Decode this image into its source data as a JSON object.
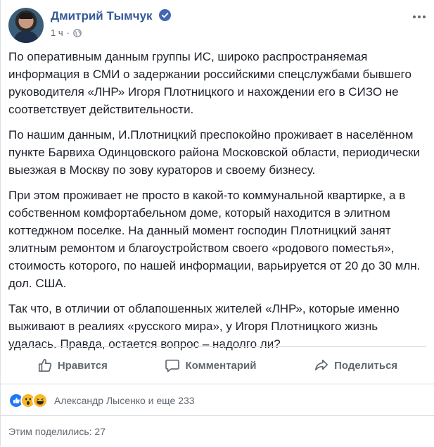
{
  "post": {
    "author": "Дмитрий Тымчук",
    "time": "1 ч",
    "paragraphs": [
      "По оперативным данным группы ИС, широко распространяемая информация в СМИ о задержании российскими спецслужбами бывшего руководителя «ЛНР» Игоря Плотницкого и нахождении его в СИЗО не соответствует действительности.",
      "По нашим данным, И.Плотницкий преспокойно проживает в населённом пункте Барвиха Одинцовского района Московской области, периодически выезжая в Москву по зову кураторов и своему бизнесу.",
      "При этом проживает не просто в какой-то коммунальной квартирке, а в собственном комфортабельном доме, который находится в элитном коттеджном поселке. На данный момент господин Плотницкий занят элитным ремонтом и благоустройством своего «родового поместья», стоимость которого, по нашей информации, варьируется от 20 до 30 млн. дол. США.",
      "Так что, в отличии от облапошенных жителей «ЛНР», которые именно выживают в реалиях «русского мира», у Игоря Плотницкого жизнь удалась. Правда, остается вопрос – надолго ли?"
    ]
  },
  "actions": {
    "like": "Нравится",
    "comment": "Комментарий",
    "share": "Поделиться"
  },
  "reactions": {
    "text": "Александр Лысенко и еще 233",
    "icons": [
      "like-icon",
      "wow-icon",
      "haha-icon"
    ]
  },
  "shares": {
    "text": "Этим поделились: 27"
  },
  "colors": {
    "link": "#365899",
    "meta": "#616770",
    "like_blue": "#2078f4",
    "reaction_yellow": "#f7b928"
  }
}
